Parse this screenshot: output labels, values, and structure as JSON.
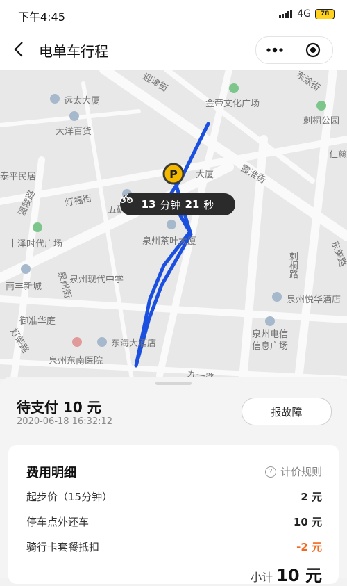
{
  "status": {
    "time": "下午4:45",
    "network": "4G",
    "battery": "78"
  },
  "nav": {
    "title": "电单车行程"
  },
  "map": {
    "labels": {
      "yingjin": "迎津街",
      "dongtu": "东涂街",
      "yuantai": "远太大厦",
      "jindi": "金帝文化广场",
      "citong": "刺桐公园",
      "dayang": "大洋百货",
      "renci": "仁慈",
      "taiping": "泰平民居",
      "wenling": "温陵路",
      "hexian": "霞淮街",
      "dengfu": "灯福街",
      "wukuang": "五矿大厦",
      "fengze": "丰泽时代广场",
      "chaye": "泉州茶叶大厦",
      "citonglu": "刺桐路",
      "dongjie": "东美路",
      "nanfeng": "南丰新城",
      "xiandai": "泉州现代中学",
      "quanzhoujie": "泉州街",
      "yuehua": "泉州悦华酒店",
      "yuhua": "御准华庭",
      "dianxin": "泉州电信\n信息广场",
      "dengcai": "灯柴路",
      "donghai": "东海大酒店",
      "dongnan": "泉州东南医院",
      "jiuyi": "九一路",
      "tda": "大厦"
    },
    "ride_time": {
      "minutes": "13",
      "min_label": "分钟",
      "seconds": "21",
      "sec_label": "秒"
    },
    "parking_badge": "P"
  },
  "order": {
    "title": "待支付 10 元",
    "datetime": "2020-06-18 16:32:12",
    "report_label": "报故障"
  },
  "fees": {
    "title": "费用明细",
    "rule_label": "计价规则",
    "items": [
      {
        "label": "起步价（15分钟）",
        "amount": "2 元"
      },
      {
        "label": "停车点外还车",
        "amount": "10 元"
      },
      {
        "label": "骑行卡套餐抵扣",
        "amount": "-2 元"
      }
    ],
    "subtotal_label": "小计",
    "subtotal_value": "10 元"
  },
  "colors": {
    "route": "#1a4fe0",
    "accent": "#f06a21",
    "parking": "#f5b800"
  }
}
